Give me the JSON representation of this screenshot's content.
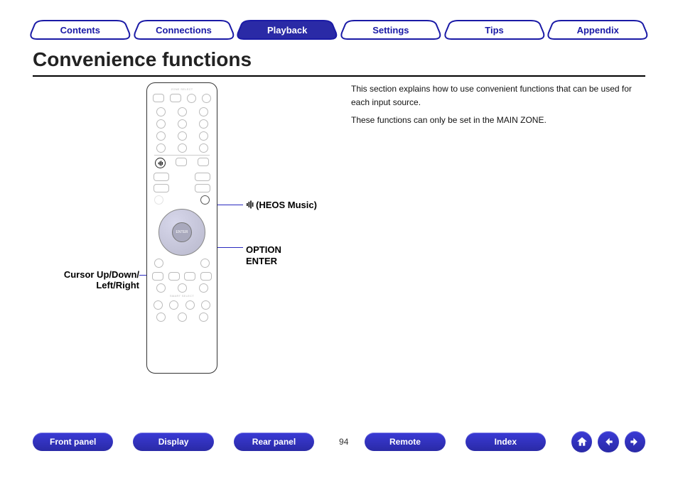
{
  "tabs": {
    "contents": "Contents",
    "connections": "Connections",
    "playback": "Playback",
    "settings": "Settings",
    "tips": "Tips",
    "appendix": "Appendix",
    "active": "playback"
  },
  "heading": "Convenience functions",
  "body": {
    "p1": "This section explains how to use convenient functions that can be used for each input source.",
    "p2": "These functions can only be set in the MAIN ZONE."
  },
  "callouts": {
    "heos": "(HEOS Music)",
    "option": "OPTION",
    "enter": "ENTER",
    "cursor_l1": "Cursor Up/Down/",
    "cursor_l2": "Left/Right"
  },
  "remote": {
    "enter_label": "ENTER"
  },
  "bottom": {
    "front_panel": "Front panel",
    "display": "Display",
    "rear_panel": "Rear panel",
    "remote": "Remote",
    "index": "Index",
    "page": "94"
  }
}
